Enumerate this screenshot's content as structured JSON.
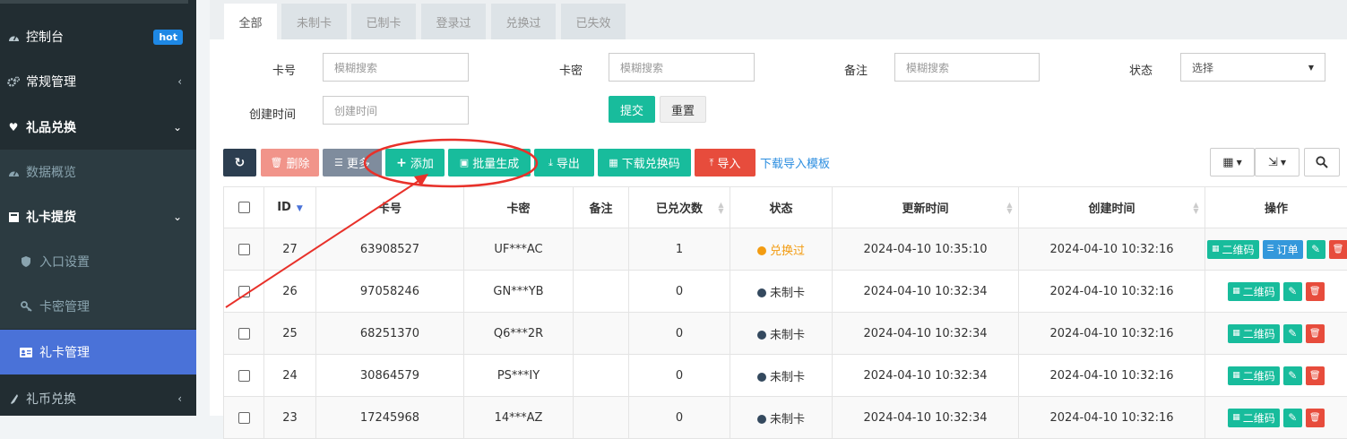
{
  "sidebar": {
    "items": [
      {
        "label": "控制台",
        "badge": "hot",
        "icon": "dashboard-icon"
      },
      {
        "label": "常规管理",
        "icon": "cogs-icon",
        "chevron": "‹"
      },
      {
        "label": "礼品兑换",
        "icon": "heart-icon",
        "chevron": "⌄"
      },
      {
        "label": "数据概览",
        "icon": "dashboard-icon"
      },
      {
        "label": "礼卡提货",
        "icon": "gift-icon",
        "chevron": "⌄"
      },
      {
        "label": "入口设置",
        "icon": "shield-icon"
      },
      {
        "label": "卡密管理",
        "icon": "key-icon"
      },
      {
        "label": "礼卡管理",
        "icon": "id-card-icon"
      },
      {
        "label": "礼币兑换",
        "icon": "coin-icon",
        "chevron": "‹"
      }
    ]
  },
  "tabs": [
    "全部",
    "未制卡",
    "已制卡",
    "登录过",
    "兑换过",
    "已失效"
  ],
  "filters": {
    "card_no_label": "卡号",
    "card_no_placeholder": "模糊搜索",
    "card_pw_label": "卡密",
    "card_pw_placeholder": "模糊搜索",
    "remark_label": "备注",
    "remark_placeholder": "模糊搜索",
    "status_label": "状态",
    "status_value": "选择",
    "created_label": "创建时间",
    "created_placeholder": "创建时间",
    "submit": "提交",
    "reset": "重置"
  },
  "toolbar": {
    "delete": "删除",
    "more": "更多",
    "add": "添加",
    "batch": "批量生成",
    "export": "导出",
    "download_codes": "下载兑换码",
    "import": "导入",
    "template_link": "下载导入模板"
  },
  "table": {
    "headers": [
      "ID",
      "卡号",
      "卡密",
      "备注",
      "已兑次数",
      "状态",
      "更新时间",
      "创建时间",
      "操作"
    ],
    "rows": [
      {
        "id": "27",
        "card": "63908527",
        "pw": "UF***AC",
        "remark": "",
        "count": "1",
        "status": "兑换过",
        "updated": "2024-04-10 10:35:10",
        "created": "2024-04-10 10:32:16"
      },
      {
        "id": "26",
        "card": "97058246",
        "pw": "GN***YB",
        "remark": "",
        "count": "0",
        "status": "未制卡",
        "updated": "2024-04-10 10:32:34",
        "created": "2024-04-10 10:32:16"
      },
      {
        "id": "25",
        "card": "68251370",
        "pw": "Q6***2R",
        "remark": "",
        "count": "0",
        "status": "未制卡",
        "updated": "2024-04-10 10:32:34",
        "created": "2024-04-10 10:32:16"
      },
      {
        "id": "24",
        "card": "30864579",
        "pw": "PS***IY",
        "remark": "",
        "count": "0",
        "status": "未制卡",
        "updated": "2024-04-10 10:32:34",
        "created": "2024-04-10 10:32:16"
      },
      {
        "id": "23",
        "card": "17245968",
        "pw": "14***AZ",
        "remark": "",
        "count": "0",
        "status": "未制卡",
        "updated": "2024-04-10 10:32:34",
        "created": "2024-04-10 10:32:16"
      }
    ],
    "op_qr": "二维码",
    "op_order": "订单"
  },
  "colors": {
    "accent": "#18bc9c",
    "active_nav": "#4a72d8",
    "sidebar_bg": "#222d32",
    "annotation": "#e8312a"
  }
}
